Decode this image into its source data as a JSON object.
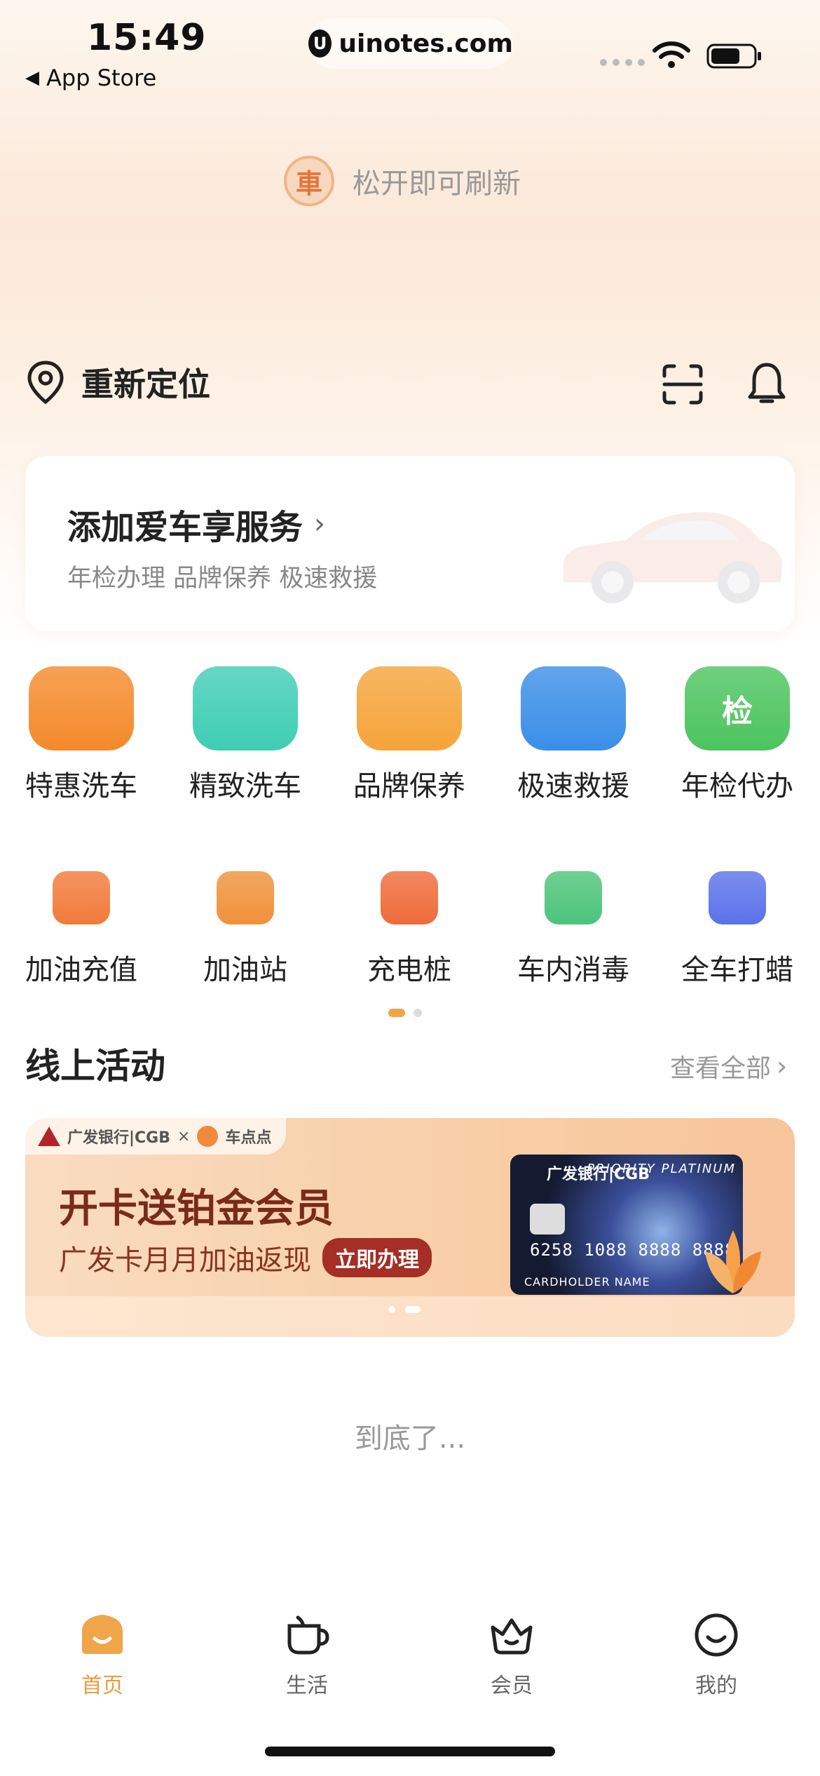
{
  "status_bar": {
    "time": "15:49",
    "back_label": "App Store",
    "url": "uinotes.com",
    "url_icon": "U"
  },
  "refresh": {
    "logo_char": "車",
    "text": "松开即可刷新"
  },
  "location": {
    "label": "重新定位"
  },
  "car_card": {
    "title": "添加爱车享服务",
    "subtitle": "年检办理 品牌保养 极速救援"
  },
  "services": [
    {
      "label": "特惠洗车",
      "icon": "car-wash-drop-icon",
      "color": "#f48a2a"
    },
    {
      "label": "精致洗车",
      "icon": "car-wash-sparkle-icon",
      "color": "#3fcdb4"
    },
    {
      "label": "品牌保养",
      "icon": "maintenance-icon",
      "color": "#f5a43a"
    },
    {
      "label": "极速救援",
      "icon": "warning-triangle-icon",
      "color": "#3a8ee8"
    },
    {
      "label": "年检代办",
      "icon": "inspection-icon",
      "color": "#4cc45e",
      "glyph": "检"
    },
    {
      "label": "加油充值",
      "icon": "fuel-card-icon",
      "color": "#f27a3a"
    },
    {
      "label": "加油站",
      "icon": "gas-station-icon",
      "color": "#f0913a"
    },
    {
      "label": "充电桩",
      "icon": "charging-pile-icon",
      "color": "#ef6a3a"
    },
    {
      "label": "车内消毒",
      "icon": "disinfect-spray-icon",
      "color": "#4cc47a"
    },
    {
      "label": "全车打蜡",
      "icon": "wax-icon",
      "color": "#5a72ea"
    }
  ],
  "section": {
    "title": "线上活动",
    "more": "查看全部"
  },
  "banner": {
    "partner_bank": "广发银行|CGB",
    "partner_x": "×",
    "partner_app": "车点点",
    "title": "开卡送铂金会员",
    "subtitle": "广发卡月月加油返现",
    "button": "立即办理",
    "card_bank": "广发银行|CGB",
    "card_tier": "PRIORITY PLATINUM",
    "card_number": "6258 1088 8888 8888",
    "card_holder": "CARDHOLDER NAME"
  },
  "footer_text": "到底了...",
  "tabs": [
    {
      "label": "首页",
      "icon": "home-icon",
      "active": true
    },
    {
      "label": "生活",
      "icon": "cup-icon",
      "active": false
    },
    {
      "label": "会员",
      "icon": "crown-basket-icon",
      "active": false
    },
    {
      "label": "我的",
      "icon": "smile-icon",
      "active": false
    }
  ],
  "colors": {
    "accent": "#f09a3a",
    "text": "#222222",
    "muted": "#999999"
  }
}
